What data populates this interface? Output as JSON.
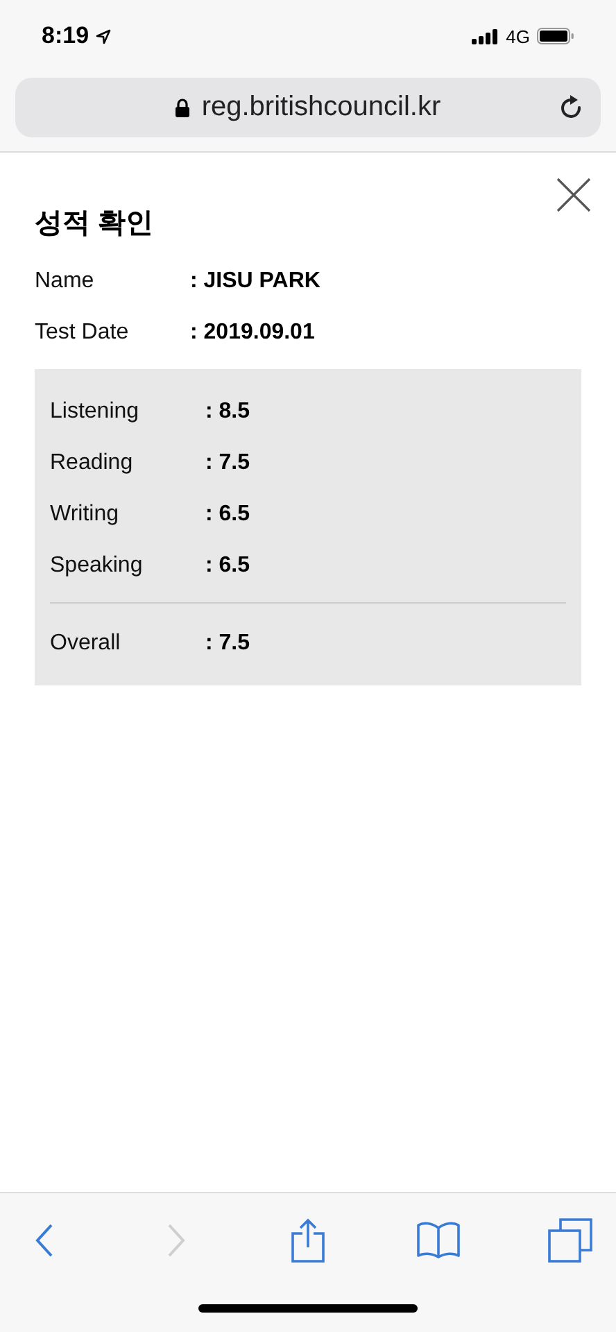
{
  "status_bar": {
    "time": "8:19",
    "network": "4G"
  },
  "address_bar": {
    "url": "reg.britishcouncil.kr"
  },
  "page": {
    "title": "성적 확인",
    "details": [
      {
        "label": "Name",
        "value": ": JISU PARK"
      },
      {
        "label": "Test Date",
        "value": ": 2019.09.01"
      }
    ],
    "scores": [
      {
        "kind": "band",
        "label": "Listening",
        "value": ": 8.5"
      },
      {
        "kind": "band",
        "label": "Reading",
        "value": ": 7.5"
      },
      {
        "kind": "band",
        "label": "Writing",
        "value": ": 6.5"
      },
      {
        "kind": "band",
        "label": "Speaking",
        "value": ": 6.5"
      },
      {
        "kind": "overall",
        "label": "Overall",
        "value": ": 7.5"
      }
    ]
  },
  "toolbar": [
    {
      "kind": "back",
      "disabled": false
    },
    {
      "kind": "forward",
      "disabled": true
    },
    {
      "kind": "share",
      "disabled": false
    },
    {
      "kind": "bookmarks",
      "disabled": false
    },
    {
      "kind": "tabs",
      "disabled": false
    }
  ]
}
